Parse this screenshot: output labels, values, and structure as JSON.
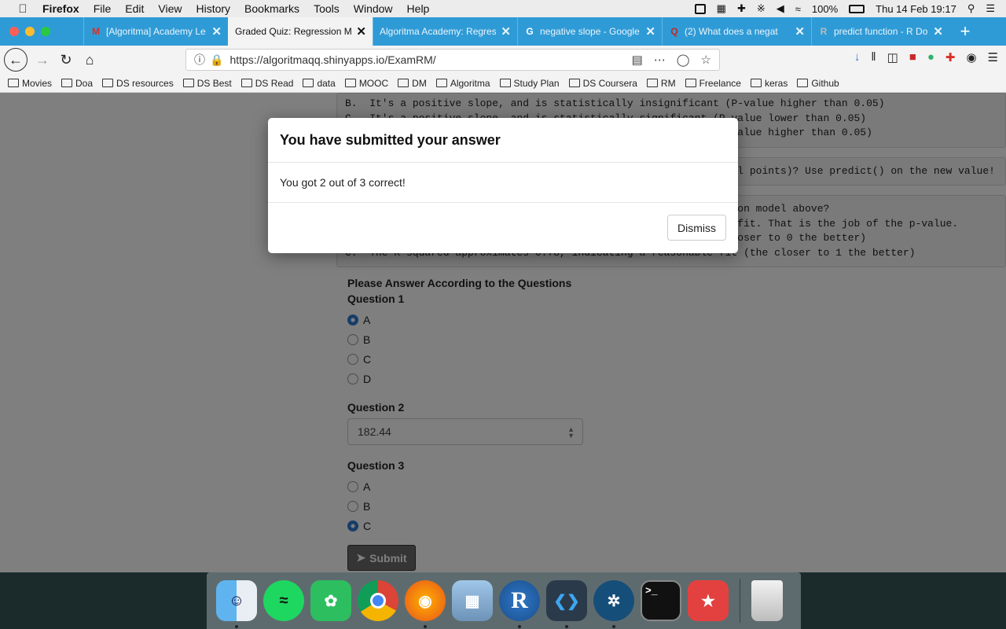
{
  "menubar": {
    "apple": "",
    "items": [
      "Firefox",
      "File",
      "Edit",
      "View",
      "History",
      "Bookmarks",
      "Tools",
      "Window",
      "Help"
    ],
    "battery": "100%",
    "datetime": "Thu 14 Feb  19:17"
  },
  "tabs": [
    {
      "title": "[Algoritma] Academy Le",
      "icon": "gmail-icon"
    },
    {
      "title": "Graded Quiz: Regression M",
      "icon": "none"
    },
    {
      "title": "Algoritma Academy: Regres",
      "icon": "none"
    },
    {
      "title": "negative slope - Google",
      "icon": "google-icon"
    },
    {
      "title": "(2) What does a negat",
      "icon": "quora-icon"
    },
    {
      "title": "predict function - R Do",
      "icon": "r-icon"
    }
  ],
  "url": "https://algoritmaqq.shinyapps.io/ExamRM/",
  "bookmarks": [
    "Movies",
    "Doa",
    "DS resources",
    "DS Best",
    "DS Read",
    "data",
    "MOOC",
    "DM",
    "Algoritma",
    "Study Plan",
    "DS Coursera",
    "RM",
    "Freelance",
    "keras",
    "Github"
  ],
  "background_text": {
    "block1": [
      "B.  It's a positive slope, and is statistically insignificant (P-value higher than 0.05)",
      "C.  It's a positive slope, and is statistically significant (P-value lower than 0.05)",
      "                                                              -value higher than 0.05)"
    ],
    "block2": "                                                               al points)? Use predict() on the new value!",
    "block3": [
      "                                                              sion model above?",
      "                                                              l fit. That is the job of the p-value.",
      "                                                              closer to 0 the better)",
      "C.  The R-squared approximates 0.78, indicating a reasonable fit (the closer to 1 the better)"
    ]
  },
  "form": {
    "heading": "Please Answer According to the Questions",
    "q1_title": "Question 1",
    "q1_options": [
      "A",
      "B",
      "C",
      "D"
    ],
    "q1_selected": "A",
    "q2_title": "Question 2",
    "q2_value": "182.44",
    "q3_title": "Question 3",
    "q3_options": [
      "A",
      "B",
      "C"
    ],
    "q3_selected": "C",
    "submit_label": "Submit"
  },
  "modal": {
    "title": "You have submitted your answer",
    "body": "You got 2 out of 3 correct!",
    "dismiss_label": "Dismiss"
  },
  "dock": [
    "Finder",
    "Spotify",
    "Evernote",
    "Chrome",
    "Firefox",
    "Preview",
    "R",
    "VS Code",
    "Sourcetree",
    "Terminal",
    "Wunderlist",
    "Trash"
  ],
  "colors": {
    "accent": "#2f7bd1",
    "tabbar": "#2f9bd6"
  }
}
